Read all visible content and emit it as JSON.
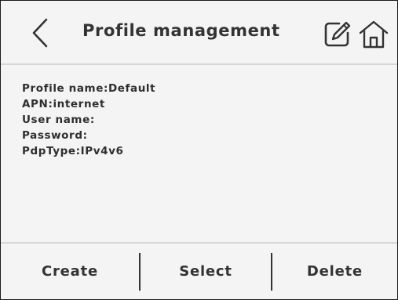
{
  "header": {
    "title": "Profile management",
    "back_icon": "chevron-left-icon",
    "edit_icon": "edit-icon",
    "home_icon": "home-icon"
  },
  "profile": {
    "lines": [
      "Profile name:Default",
      "APN:internet",
      "User name:",
      "Password:",
      "PdpType:IPv4v6"
    ]
  },
  "footer": {
    "create_label": "Create",
    "select_label": "Select",
    "delete_label": "Delete"
  },
  "colors": {
    "background": "#f4f4f4",
    "text": "#333333",
    "separator": "#d6d6d6"
  }
}
